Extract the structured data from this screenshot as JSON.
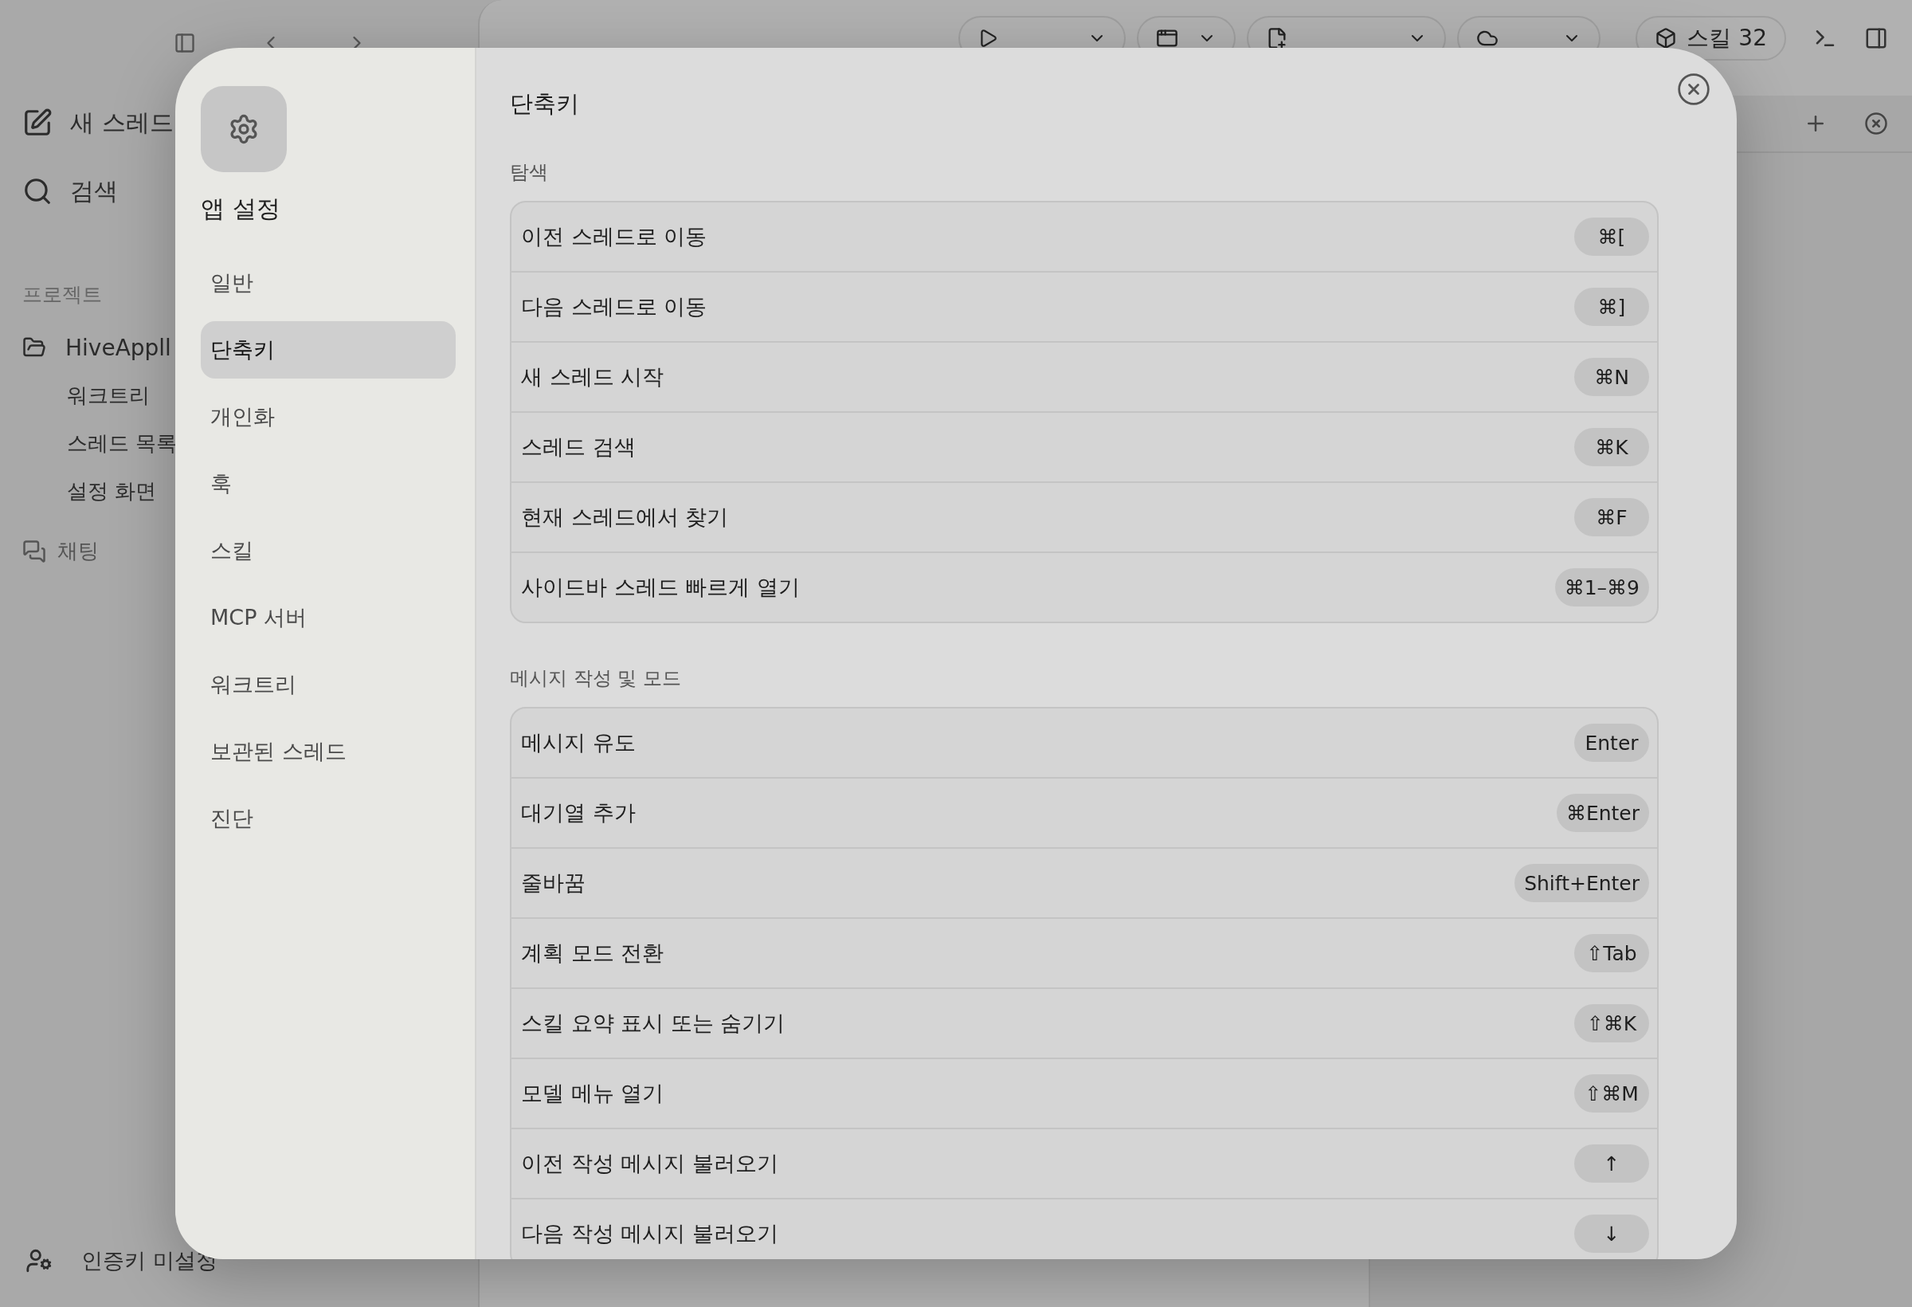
{
  "sidebar": {
    "actions": [
      {
        "label": "새 스레드",
        "kind": "compose"
      },
      {
        "label": "검색",
        "kind": "search"
      }
    ],
    "section_label": "프로젝트",
    "project": {
      "name": "HiveAppll",
      "threads": [
        "워크트리",
        "스레드 목록",
        "설정 화면"
      ]
    },
    "chat": "채팅",
    "account": "인증키 미설정"
  },
  "toolbar": {
    "buttons": [
      {
        "kind": "run"
      },
      {
        "kind": "app"
      },
      {
        "kind": "diff"
      },
      {
        "kind": "commit"
      }
    ],
    "skills": "스킬 32"
  },
  "settings": {
    "title": "앱 설정",
    "nav": [
      {
        "label": "일반",
        "selected": false
      },
      {
        "label": "단축키",
        "selected": true
      },
      {
        "label": "개인화",
        "selected": false
      },
      {
        "label": "훅",
        "selected": false
      },
      {
        "label": "스킬",
        "selected": false
      },
      {
        "label": "MCP 서버",
        "selected": false
      },
      {
        "label": "워크트리",
        "selected": false
      },
      {
        "label": "보관된 스레드",
        "selected": false
      },
      {
        "label": "진단",
        "selected": false
      }
    ],
    "page_title": "단축키",
    "sections": [
      {
        "title": "탐색",
        "shortcuts": [
          {
            "action": "이전 스레드로 이동",
            "keys": "⌘["
          },
          {
            "action": "다음 스레드로 이동",
            "keys": "⌘]"
          },
          {
            "action": "새 스레드 시작",
            "keys": "⌘N"
          },
          {
            "action": "스레드 검색",
            "keys": "⌘K"
          },
          {
            "action": "현재 스레드에서 찾기",
            "keys": "⌘F"
          },
          {
            "action": "사이드바 스레드 빠르게 열기",
            "keys": "⌘1–⌘9"
          }
        ]
      },
      {
        "title": "메시지 작성 및 모드",
        "shortcuts": [
          {
            "action": "메시지 유도",
            "keys": "Enter"
          },
          {
            "action": "대기열 추가",
            "keys": "⌘Enter"
          },
          {
            "action": "줄바꿈",
            "keys": "Shift+Enter"
          },
          {
            "action": "계획 모드 전환",
            "keys": "⇧Tab"
          },
          {
            "action": "스킬 요약 표시 또는 숨기기",
            "keys": "⇧⌘K"
          },
          {
            "action": "모델 메뉴 열기",
            "keys": "⇧⌘M"
          },
          {
            "action": "이전 작성 메시지 불러오기",
            "keys": "↑"
          },
          {
            "action": "다음 작성 메시지 불러오기",
            "keys": "↓"
          }
        ]
      }
    ]
  }
}
